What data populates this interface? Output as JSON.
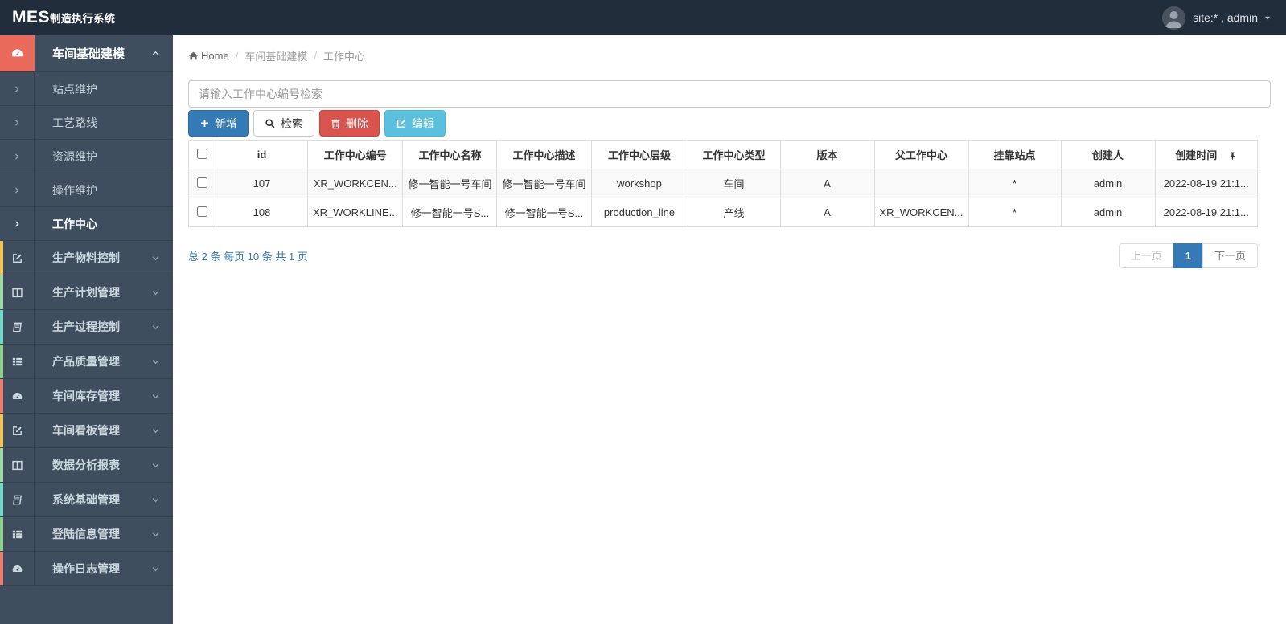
{
  "topbar": {
    "logo_bold": "MES",
    "logo_rest": "制造执行系统",
    "user_label": "site:* , admin"
  },
  "sidebar": {
    "group": {
      "label": "车间基础建模",
      "icon": "gauge-icon",
      "expanded": true
    },
    "submenu": [
      {
        "label": "站点维护",
        "active": false
      },
      {
        "label": "工艺路线",
        "active": false
      },
      {
        "label": "资源维护",
        "active": false
      },
      {
        "label": "操作维护",
        "active": false
      },
      {
        "label": "工作中心",
        "active": true
      }
    ],
    "items": [
      {
        "label": "生产物料控制",
        "icon": "pencil-square-icon",
        "strip_color": "#efc35c"
      },
      {
        "label": "生产计划管理",
        "icon": "columns-icon",
        "strip_color": "#a4d7a6"
      },
      {
        "label": "生产过程控制",
        "icon": "book-icon",
        "strip_color": "#74d6c8"
      },
      {
        "label": "产品质量管理",
        "icon": "th-list-icon",
        "strip_color": "#8fce91"
      },
      {
        "label": "车间库存管理",
        "icon": "gauge-icon",
        "strip_color": "#e87f73"
      },
      {
        "label": "车间看板管理",
        "icon": "pencil-square-icon",
        "strip_color": "#efc35c"
      },
      {
        "label": "数据分析报表",
        "icon": "columns-icon",
        "strip_color": "#a4d7a6"
      },
      {
        "label": "系统基础管理",
        "icon": "book-icon",
        "strip_color": "#74d6c8"
      },
      {
        "label": "登陆信息管理",
        "icon": "th-list-icon",
        "strip_color": "#8fce91"
      },
      {
        "label": "操作日志管理",
        "icon": "gauge-icon",
        "strip_color": "#e87f73"
      }
    ]
  },
  "breadcrumb": {
    "home": "Home",
    "crumb1": "车间基础建模",
    "crumb2": "工作中心"
  },
  "search": {
    "placeholder": "请输入工作中心编号检索",
    "value": ""
  },
  "toolbar": {
    "add_label": "新增",
    "search_label": "检索",
    "delete_label": "删除",
    "edit_label": "编辑"
  },
  "table": {
    "headers": [
      "id",
      "工作中心编号",
      "工作中心名称",
      "工作中心描述",
      "工作中心层级",
      "工作中心类型",
      "版本",
      "父工作中心",
      "挂靠站点",
      "创建人",
      "创建时间"
    ],
    "rows": [
      [
        "107",
        "XR_WORKCEN...",
        "修一智能一号车间",
        "修一智能一号车间",
        "workshop",
        "车间",
        "A",
        "",
        "*",
        "admin",
        "2022-08-19 21:1..."
      ],
      [
        "108",
        "XR_WORKLINE...",
        "修一智能一号S...",
        "修一智能一号S...",
        "production_line",
        "产线",
        "A",
        "XR_WORKCEN...",
        "*",
        "admin",
        "2022-08-19 21:1..."
      ]
    ]
  },
  "pagination": {
    "summary": "总 2 条  每页 10 条  共 1 页",
    "prev_label": "上一页",
    "current_page": "1",
    "next_label": "下一页"
  },
  "colors": {
    "topbar_bg": "#222d3c",
    "sidebar_bg": "#3e4e5e",
    "active_group_icon_bg": "#e96a5a",
    "primary": "#337ab7",
    "danger": "#d9534f",
    "info": "#5bc0de",
    "table_border": "#dddddd",
    "striped_row": "#f9f9f9",
    "strip_cycle": [
      "#efc35c",
      "#a4d7a6",
      "#74d6c8",
      "#8fce91",
      "#e87f73"
    ]
  }
}
